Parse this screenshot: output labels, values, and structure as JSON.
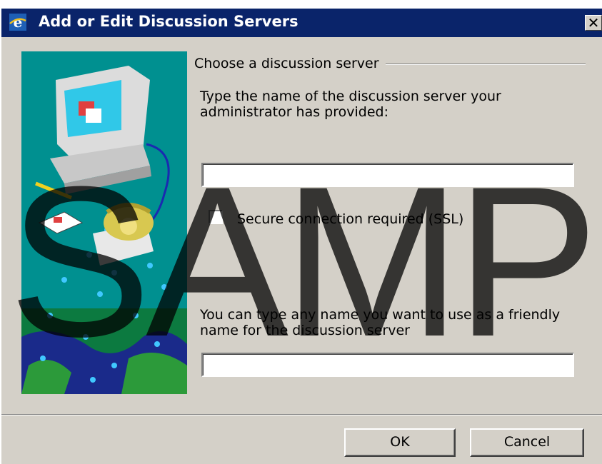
{
  "window": {
    "title": "Add or Edit Discussion Servers",
    "close_glyph": "✕"
  },
  "group": {
    "title": "Choose a discussion server"
  },
  "server_name": {
    "prompt": "Type the name of the discussion server your administrator has provided:",
    "prompt_line1": "Type the name of the discussion server your",
    "prompt_line2": "administrator has provided:",
    "value": ""
  },
  "ssl": {
    "label": "Secure connection required (SSL)",
    "checked": false
  },
  "friendly_name": {
    "prompt_line1": "You can type any name you want to use as a friendly",
    "prompt_line2": "name for the discussion server",
    "value": ""
  },
  "buttons": {
    "ok": "OK",
    "cancel": "Cancel"
  },
  "watermark": {
    "text": "SAMP"
  },
  "icons": {
    "app": "internet-explorer-icon",
    "close": "close-icon",
    "illustration": "network-computer-phone-illustration"
  },
  "colors": {
    "titlebar": "#0a246a",
    "dialog": "#d4d0c8",
    "illustration_bg": "#009090"
  }
}
